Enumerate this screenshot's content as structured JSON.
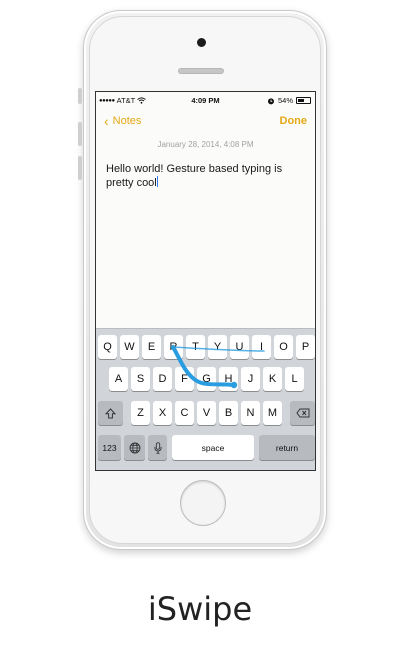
{
  "status_bar": {
    "carrier": "AT&T",
    "time": "4:09 PM",
    "battery": "54%",
    "battery_level": 0.54
  },
  "nav": {
    "back_label": "Notes",
    "done_label": "Done"
  },
  "note": {
    "date": "January 28, 2014, 4:08 PM",
    "text": "Hello world! Gesture based typing is pretty cool"
  },
  "keyboard": {
    "row1": [
      "Q",
      "W",
      "E",
      "R",
      "T",
      "Y",
      "U",
      "I",
      "O",
      "P"
    ],
    "row2": [
      "A",
      "S",
      "D",
      "F",
      "G",
      "H",
      "J",
      "K",
      "L"
    ],
    "row3": [
      "Z",
      "X",
      "C",
      "V",
      "B",
      "N",
      "M"
    ],
    "shift_icon": "shift-arrow-icon",
    "delete_icon": "delete-backspace-icon",
    "numbers_label": "123",
    "globe_icon": "globe-icon",
    "mic_icon": "microphone-icon",
    "space_label": "space",
    "return_label": "return"
  },
  "caption": "iSwipe",
  "colors": {
    "accent": "#e5a915",
    "swipe_trail": "#2a9de0",
    "cursor": "#2f7cf6"
  }
}
